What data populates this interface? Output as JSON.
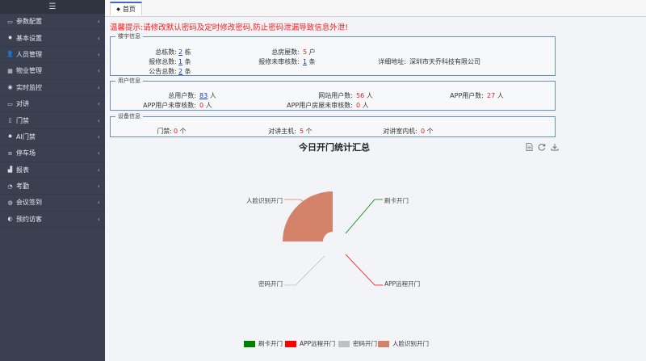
{
  "sidebar": {
    "toggle_icon": "menu-icon",
    "items": [
      {
        "label": "参数配置",
        "icon": "monitor-icon"
      },
      {
        "label": "基本设置",
        "icon": "gear-icon"
      },
      {
        "label": "人员管理",
        "icon": "user-icon"
      },
      {
        "label": "物业管理",
        "icon": "building-icon"
      },
      {
        "label": "实时监控",
        "icon": "eye-icon"
      },
      {
        "label": "对讲",
        "icon": "monitor-icon"
      },
      {
        "label": "门禁",
        "icon": "door-icon"
      },
      {
        "label": "AI门禁",
        "icon": "gear-icon"
      },
      {
        "label": "停车场",
        "icon": "list-icon"
      },
      {
        "label": "报表",
        "icon": "chart-icon"
      },
      {
        "label": "考勤",
        "icon": "clock-icon"
      },
      {
        "label": "会议签到",
        "icon": "meeting-icon"
      },
      {
        "label": "预约访客",
        "icon": "visitor-icon"
      }
    ]
  },
  "tab": {
    "label": "首页",
    "icon": "home-icon"
  },
  "warning": "温馨提示:请修改默认密码及定时修改密码,防止密码泄漏导致信息外泄!",
  "building": {
    "legend": "楼宇信息",
    "building_count_label": "总栋数:",
    "building_count": "2",
    "building_unit": "栋",
    "room_count_label": "总房屋数:",
    "room_count": "5",
    "room_unit": "户",
    "address_label": "详细地址:",
    "address": "深圳市天乔科技有限公司",
    "repair_label": "报修总数:",
    "repair_count": "1",
    "repair_unit": "条",
    "repair_pending_label": "报修未审核数:",
    "repair_pending": "1",
    "repair_pending_unit": "条",
    "notice_label": "公告总数:",
    "notice_count": "2",
    "notice_unit": "条"
  },
  "user": {
    "legend": "用户信息",
    "total_label": "总用户数:",
    "total": "83",
    "total_unit": "人",
    "web_label": "网站用户数:",
    "web": "56",
    "web_unit": "人",
    "app_label": "APP用户数:",
    "app": "27",
    "app_unit": "人",
    "app_pending_label": "APP用户未审核数:",
    "app_pending": "0",
    "app_pending_unit": "人",
    "app_room_pending_label": "APP用户房屋未审核数:",
    "app_room_pending": "0",
    "app_room_pending_unit": "人"
  },
  "device": {
    "legend": "设备信息",
    "door_label": "门禁:",
    "door": "0",
    "door_unit": "个",
    "intercom_label": "对讲主机:",
    "intercom": "5",
    "intercom_unit": "个",
    "indoor_label": "对讲室内机:",
    "indoor": "0",
    "indoor_unit": "个"
  },
  "chart_toolbar": {
    "icons": [
      "document-icon",
      "refresh-icon",
      "download-icon"
    ]
  },
  "chart_data": {
    "type": "pie",
    "title": "今日开门统计汇总",
    "rose": true,
    "categories": [
      "刷卡开门",
      "APP远程开门",
      "密码开门",
      "人脸识别开门"
    ],
    "values": [
      0,
      0,
      0,
      1
    ],
    "colors": [
      "#008000",
      "#ff0000",
      "#c0c0c0",
      "#d4826a"
    ],
    "legend_position": "bottom"
  }
}
